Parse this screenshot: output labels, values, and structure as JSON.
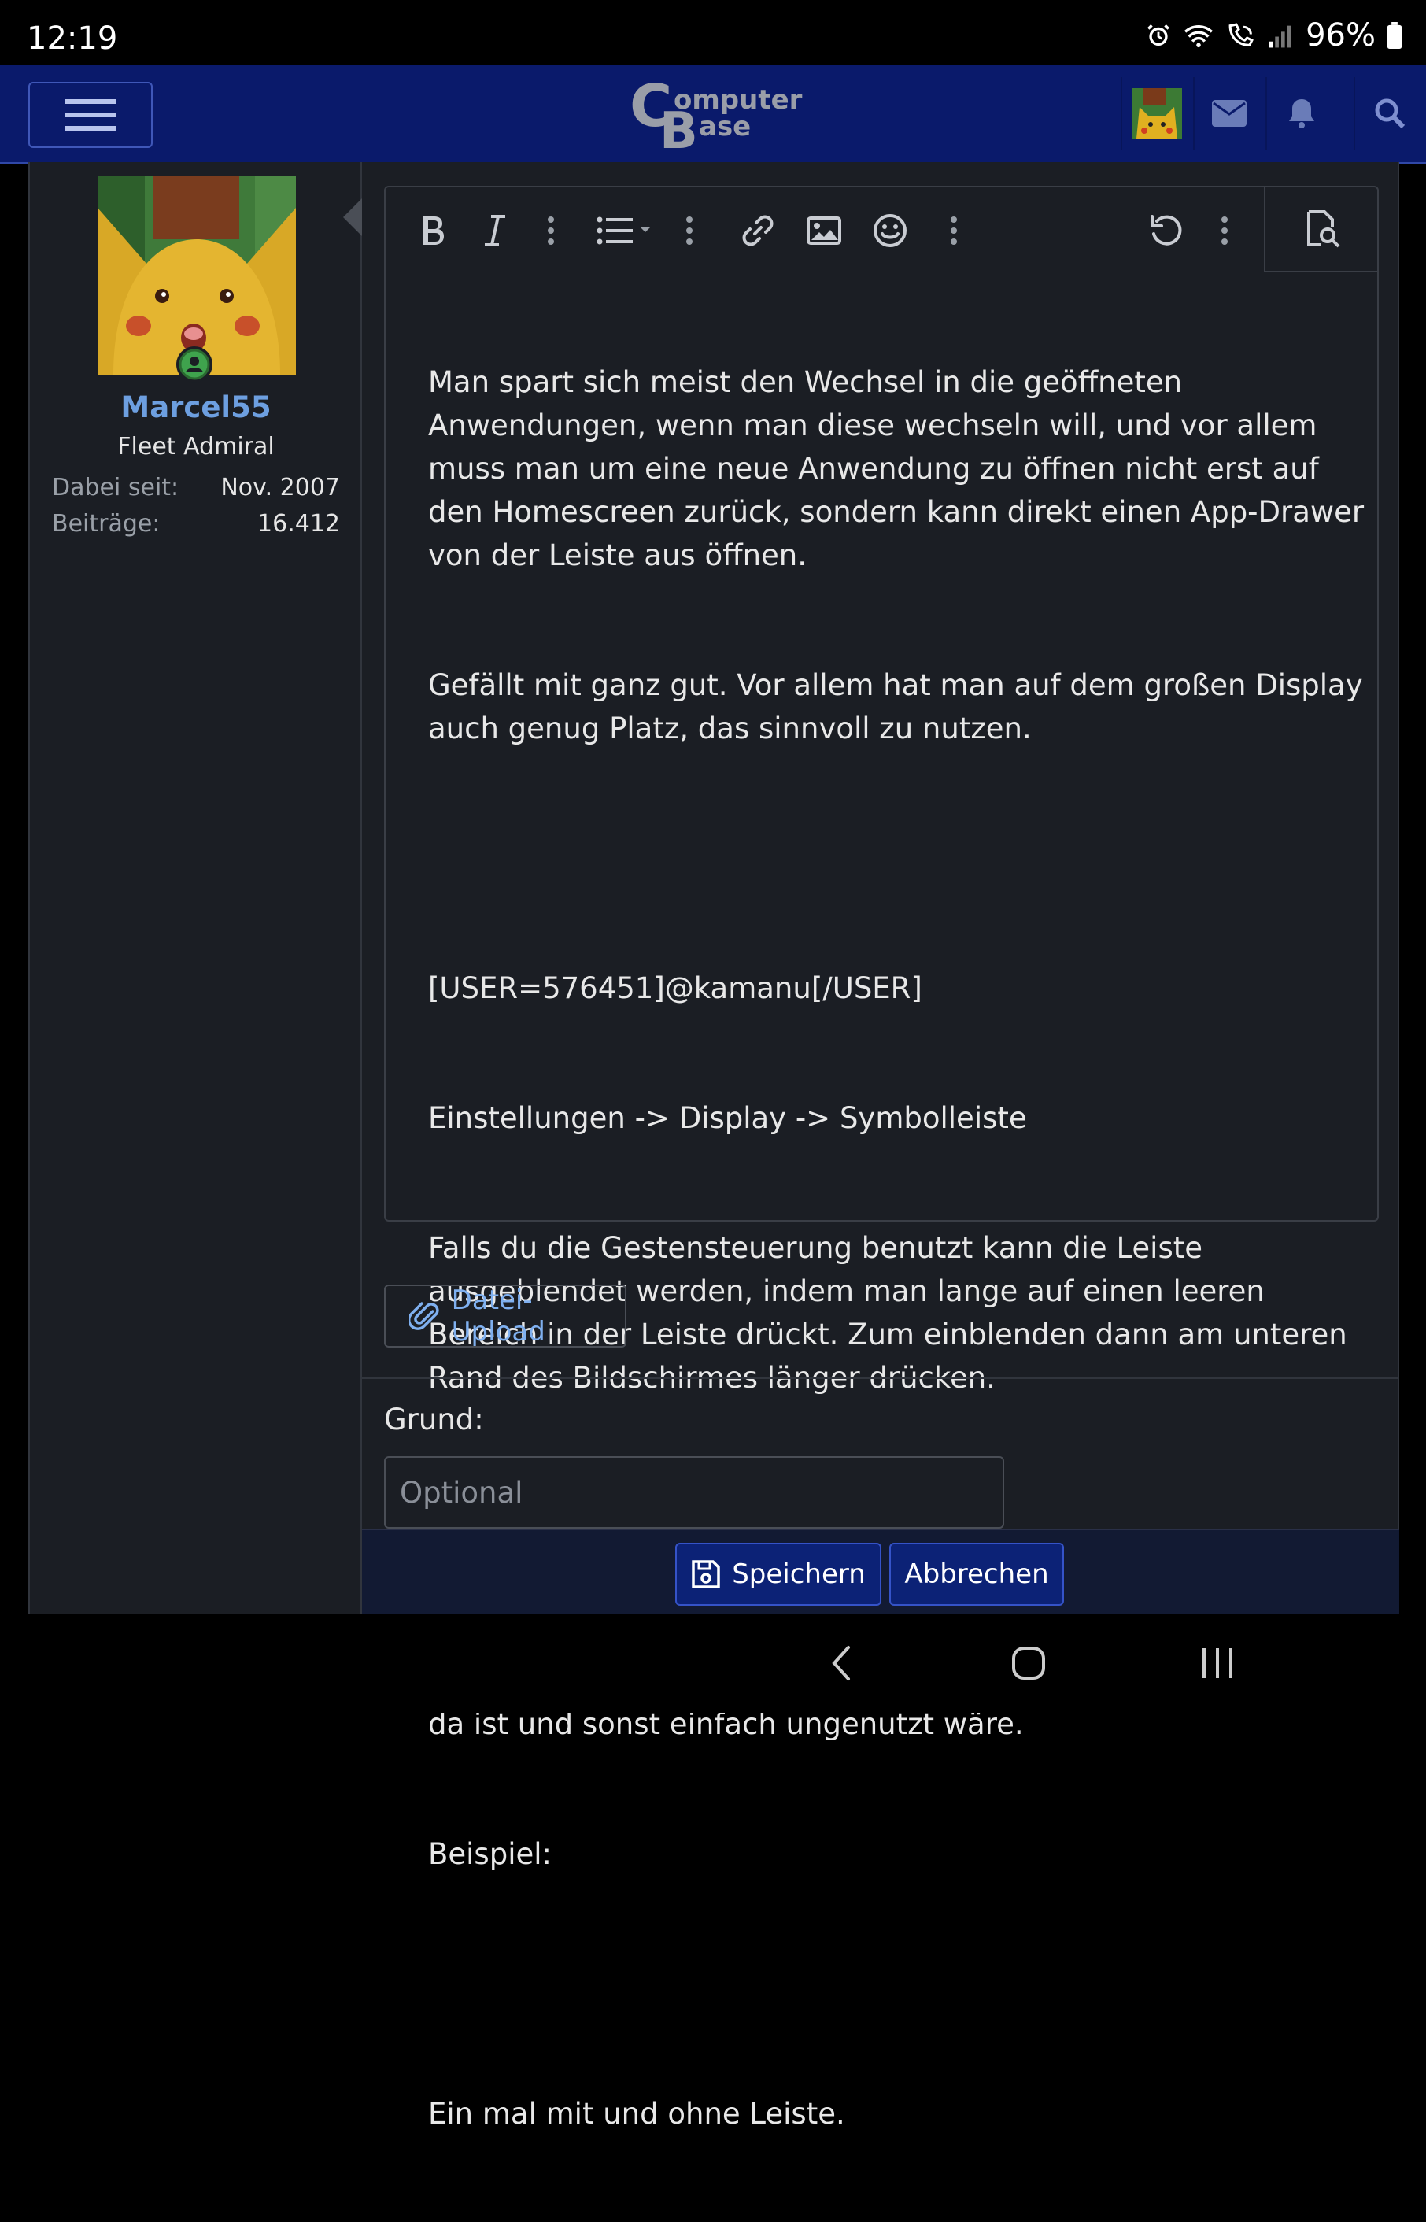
{
  "status_bar": {
    "time": "12:19",
    "battery": "96%"
  },
  "header": {
    "logo_text_top": "omputer",
    "logo_text_bottom": "ase",
    "logo_initial_c": "C",
    "logo_initial_b": "B"
  },
  "user": {
    "name": "Marcel55",
    "title": "Fleet Admiral",
    "stats": [
      {
        "label": "Dabei seit:",
        "value": "Nov. 2007"
      },
      {
        "label": "Beiträge:",
        "value": "16.412"
      }
    ]
  },
  "editor": {
    "toolbar": [
      "bold-icon",
      "italic-icon",
      "more-icon",
      "list-icon",
      "more-icon",
      "link-icon",
      "image-icon",
      "emoji-icon",
      "more-icon",
      "undo-icon",
      "more-icon",
      "preview-icon"
    ],
    "paragraphs": [
      "Man spart sich meist den Wechsel in die geöffneten Anwendungen, wenn man diese wechseln will, und vor allem muss man um eine neue Anwendung zu öffnen nicht erst auf den Homescreen zurück, sondern kann direkt einen App-Drawer von der Leiste aus öffnen.",
      "Gefällt mit ganz gut. Vor allem hat man auf dem großen Display auch genug Platz, das sinnvoll zu nutzen.",
      "",
      "[USER=576451]@kamanu[/USER]",
      "Einstellungen -> Display -> Symbolleiste",
      "Falls du die Gestensteuerung benutzt kann die Leiste ausgeblendet werden, indem man lange auf einen leeren Bereich in der Leiste drückt. Zum einblenden dann am unteren Rand des Bildschirmes länger drücken.",
      "",
      "Falls man keine Gestensteuerung nutzt ergibt es eigentlich nur wenig Sinn die Symbolleiste auszuschalten, da der Platz ja eh da ist und sonst einfach ungenutzt wäre.",
      "Beispiel:",
      "",
      "Ein mal mit und ohne Leiste."
    ]
  },
  "upload": {
    "label": "Datei-Upload"
  },
  "reason": {
    "label": "Grund:",
    "placeholder": "Optional"
  },
  "actions": {
    "save": "Speichern",
    "cancel": "Abbrechen"
  },
  "colors": {
    "header_bg": "#0a1a6b",
    "page_bg": "#1b1e24",
    "accent": "#6d9fe0",
    "button_bg": "#0c2276"
  }
}
